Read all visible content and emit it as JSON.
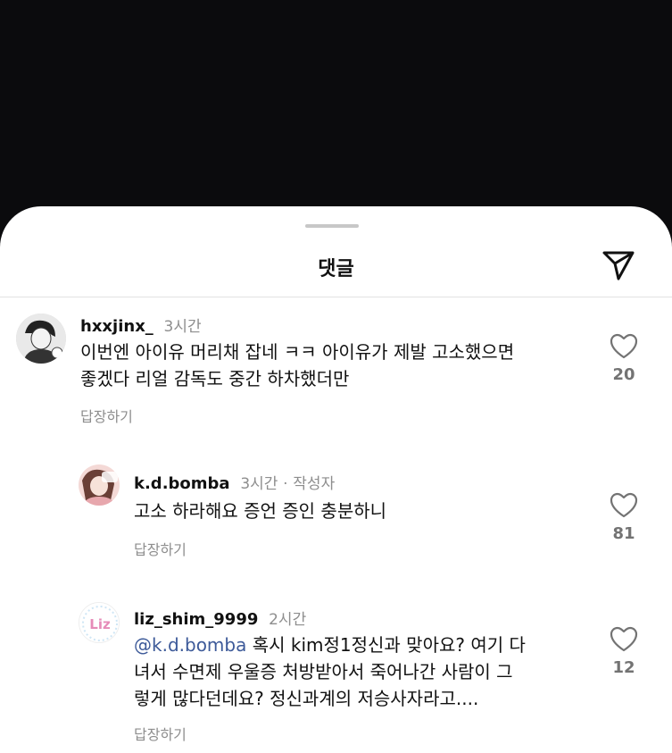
{
  "sheet": {
    "title": "댓글"
  },
  "comments": [
    {
      "username": "hxxjinx_",
      "time": "3시간",
      "text_lines": [
        "이번엔 아이유 머리채 잡네 ㅋㅋ 아이유가 제발 고소했으면",
        "좋겠다 리얼 감독도 중간 하차했더만"
      ],
      "reply_label": "답장하기",
      "likes": "20"
    },
    {
      "username": "k.d.bomba",
      "time": "3시간",
      "separator": "·",
      "author_badge": "작성자",
      "text_lines": [
        "고소 하라해요 증언 증인 충분하니"
      ],
      "reply_label": "답장하기",
      "likes": "81"
    },
    {
      "username": "liz_shim_9999",
      "time": "2시간",
      "mention": "@k.d.bomba",
      "text_lines": [
        " 혹시 kim정1정신과 맞아요? 여기 다",
        "녀서 수면제 우울증 처방받아서 죽어나간 사람이 그",
        "렇게 많다던데요? 정신과계의 저승사자라고...."
      ],
      "reply_label": "답장하기",
      "likes": "12",
      "avatar_text": "Liz"
    }
  ]
}
